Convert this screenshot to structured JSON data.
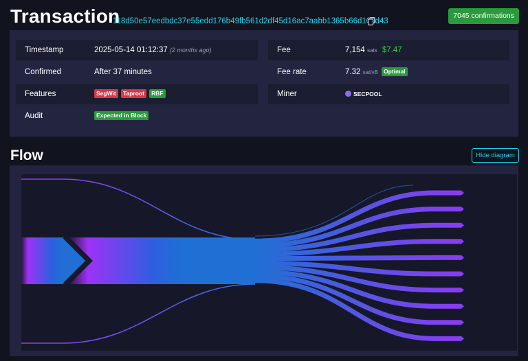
{
  "header": {
    "title": "Transaction",
    "txid": "118d50e57eedbdc37e55edd176b49fb561d2df45d16ac7aabb1365b66d100d43",
    "confirmations": "7045 confirmations"
  },
  "details": {
    "timestamp_label": "Timestamp",
    "timestamp_value": "2025-05-14 01:12:37",
    "timestamp_relative": "(2 months ago)",
    "confirmed_label": "Confirmed",
    "confirmed_value": "After 37 minutes",
    "features_label": "Features",
    "features": [
      "SegWit",
      "Taproot",
      "RBF"
    ],
    "audit_label": "Audit",
    "audit_value": "Expected in Block",
    "fee_label": "Fee",
    "fee_value": "7,154",
    "fee_unit": "sats",
    "fee_usd": "$7.47",
    "fee_rate_label": "Fee rate",
    "fee_rate_value": "7.32",
    "fee_rate_unit": "sat/vB",
    "fee_rate_badge": "Optimal",
    "miner_label": "Miner",
    "miner_value": "SECPOOL"
  },
  "flow": {
    "title": "Flow",
    "hide_button": "Hide diagram",
    "input_count": 3,
    "output_count": 10,
    "colors": {
      "input_start": "#9c32f7",
      "middle": "#1f6fd4",
      "output_end": "#8a3cf0"
    }
  },
  "colors": {
    "background": "#11131f",
    "panel": "#232540",
    "accent": "#1bd8f4",
    "green": "#2a9a3c",
    "red": "#d5374b"
  }
}
